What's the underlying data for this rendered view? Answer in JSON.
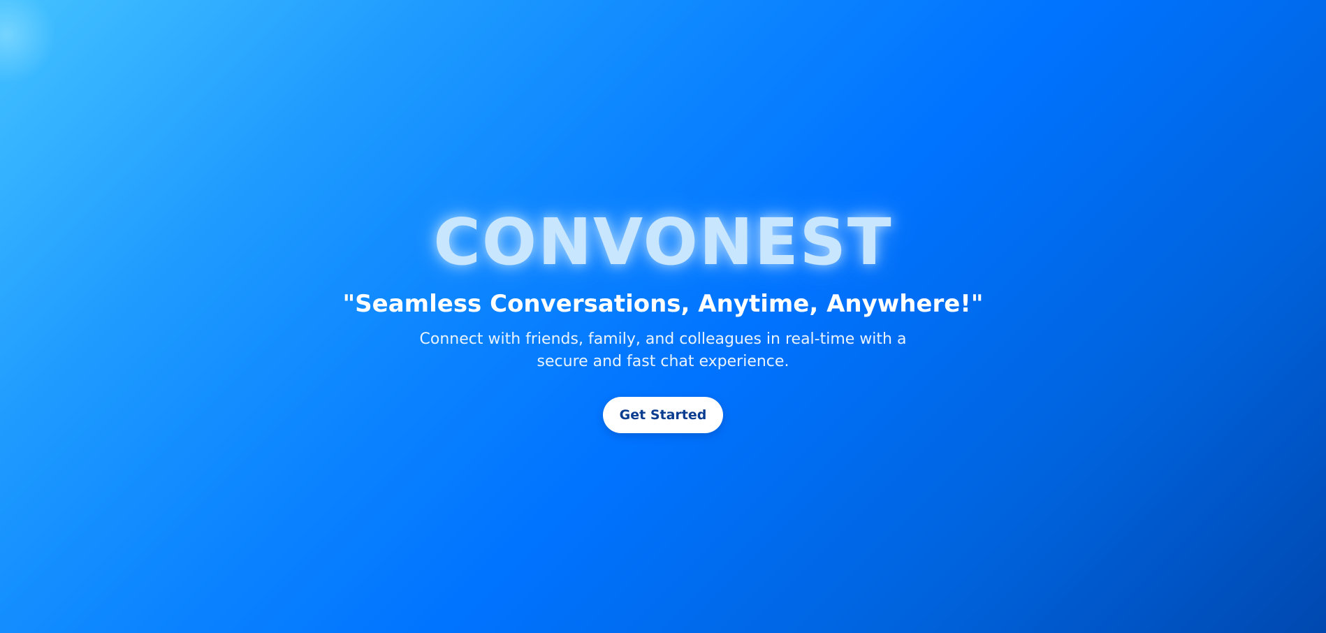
{
  "hero": {
    "brand": "CONVONEST",
    "tagline": "\"Seamless Conversations, Anytime, Anywhere!\"",
    "description": "Connect with friends, family, and colleagues in real-time with a secure and fast chat experience.",
    "cta_label": "Get Started"
  },
  "colors": {
    "background_start": "#44c2ff",
    "background_mid": "#0073ff",
    "background_end": "#0048b0",
    "brand_text": "#c9e6ff",
    "button_bg": "#ffffff",
    "button_text": "#0a3d8f"
  }
}
